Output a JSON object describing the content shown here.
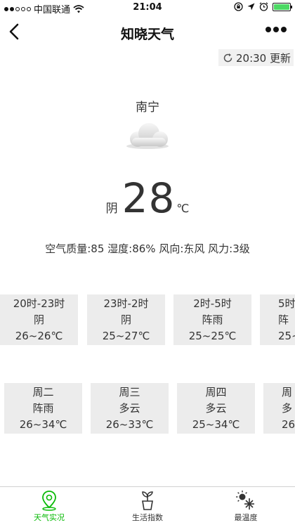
{
  "status": {
    "carrier": "中国联通",
    "time": "21:04"
  },
  "nav": {
    "title": "知晓天气"
  },
  "update": {
    "label": "20:30 更新"
  },
  "now": {
    "city": "南宁",
    "condition": "阴",
    "temperature": "28",
    "unit": "℃",
    "details": "空气质量:85 湿度:86% 风向:东风 风力:3级"
  },
  "hourly": [
    {
      "time": "20时-23时",
      "condition": "阴",
      "range": "26~26℃"
    },
    {
      "time": "23时-2时",
      "condition": "阴",
      "range": "25~27℃"
    },
    {
      "time": "2时-5时",
      "condition": "阵雨",
      "range": "25~25℃"
    },
    {
      "time": "5时",
      "condition": "阵",
      "range": "25~"
    }
  ],
  "daily": [
    {
      "day": "周二",
      "condition": "阵雨",
      "range": "26~34℃"
    },
    {
      "day": "周三",
      "condition": "多云",
      "range": "26~33℃"
    },
    {
      "day": "周四",
      "condition": "多云",
      "range": "25~34℃"
    },
    {
      "day": "周",
      "condition": "多",
      "range": "26"
    }
  ],
  "tabs": [
    {
      "label": "天气实况",
      "icon": "location-pin-icon",
      "active": true
    },
    {
      "label": "生活指数",
      "icon": "plant-pot-icon",
      "active": false
    },
    {
      "label": "最温度",
      "icon": "sun-snowflake-icon",
      "active": false
    }
  ],
  "colors": {
    "accent": "#09bb07",
    "card": "#ececec",
    "battery": "#4cd964"
  }
}
